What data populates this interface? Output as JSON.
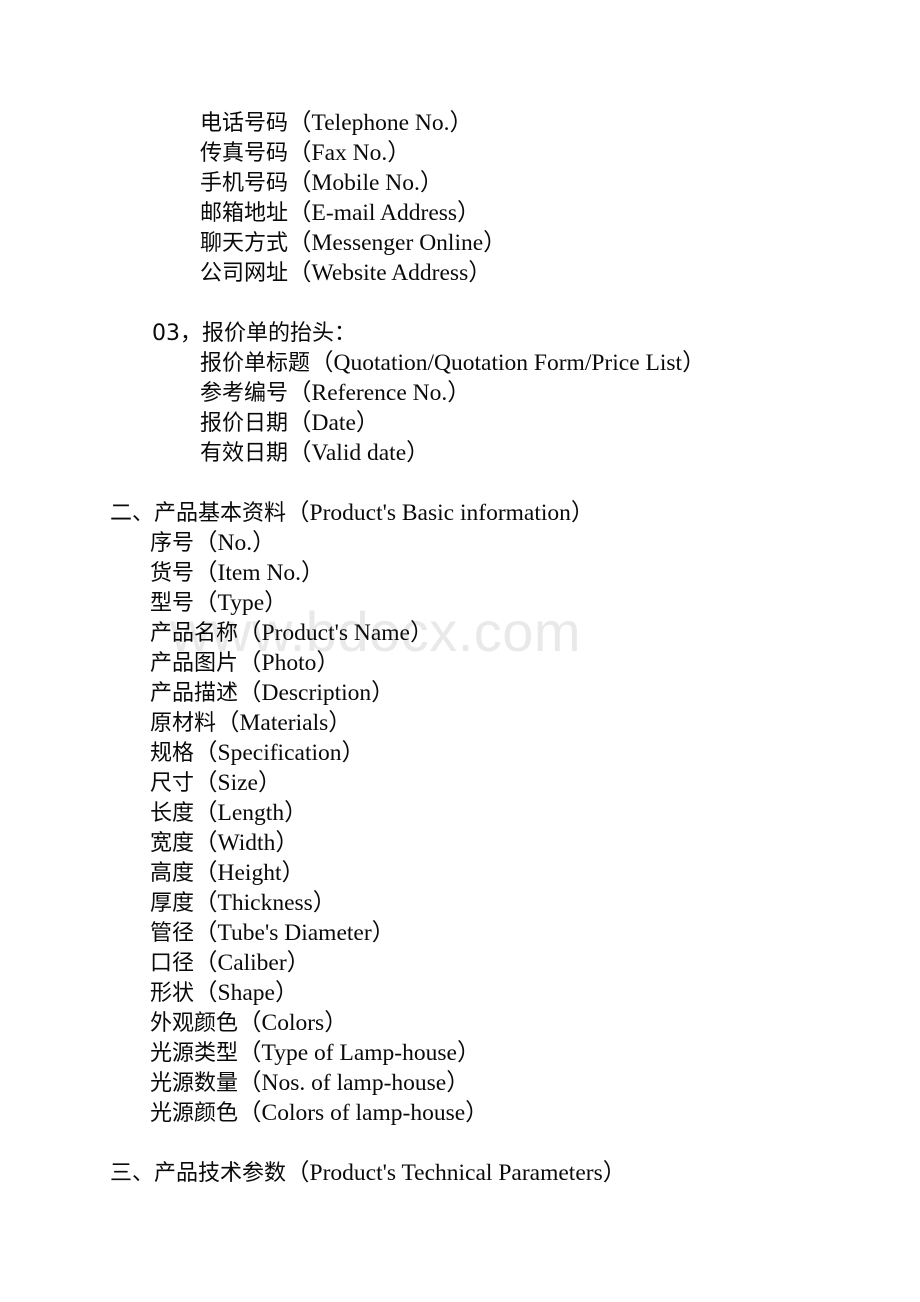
{
  "document": {
    "watermark": "www.bdocx.com",
    "blocks": [
      {
        "type": "list",
        "indent": "a",
        "items": [
          {
            "cn": "电话号码",
            "en": "（Telephone No.）"
          },
          {
            "cn": "传真号码",
            "en": "（Fax No.）"
          },
          {
            "cn": "手机号码",
            "en": "（Mobile No.）"
          },
          {
            "cn": "邮箱地址",
            "en": "（E-mail Address）"
          },
          {
            "cn": "聊天方式",
            "en": "（Messenger Online）"
          },
          {
            "cn": "公司网址",
            "en": "（Website Address）"
          }
        ]
      },
      {
        "type": "spacer"
      },
      {
        "type": "heading-num",
        "indent": "num",
        "cn": "03，报价单的抬头：",
        "en": ""
      },
      {
        "type": "list",
        "indent": "a",
        "items": [
          {
            "cn": "报价单标题",
            "en": "（Quotation/Quotation Form/Price List）"
          },
          {
            "cn": "参考编号",
            "en": "（Reference No.）"
          },
          {
            "cn": "报价日期",
            "en": "（Date）"
          },
          {
            "cn": "有效日期",
            "en": "（Valid date）"
          }
        ]
      },
      {
        "type": "spacer"
      },
      {
        "type": "heading",
        "indent": "h1",
        "cn": "二、产品基本资料",
        "en": "（Product's Basic information）"
      },
      {
        "type": "list",
        "indent": "b",
        "items": [
          {
            "cn": "序号",
            "en": "（No.）"
          },
          {
            "cn": "货号",
            "en": "（Item No.）"
          },
          {
            "cn": "型号",
            "en": "（Type）"
          },
          {
            "cn": "产品名称",
            "en": "（Product's Name）"
          },
          {
            "cn": "产品图片",
            "en": "（Photo）"
          },
          {
            "cn": "产品描述",
            "en": "（Description）"
          },
          {
            "cn": "原材料",
            "en": "（Materials）"
          },
          {
            "cn": "规格",
            "en": "（Specification）"
          },
          {
            "cn": "尺寸",
            "en": "（Size）"
          },
          {
            "cn": "长度",
            "en": "（Length）"
          },
          {
            "cn": "宽度",
            "en": "（Width）"
          },
          {
            "cn": "高度",
            "en": "（Height）"
          },
          {
            "cn": "厚度",
            "en": "（Thickness）"
          },
          {
            "cn": "管径",
            "en": "（Tube's Diameter）"
          },
          {
            "cn": "口径",
            "en": "（Caliber）"
          },
          {
            "cn": "形状",
            "en": "（Shape）"
          },
          {
            "cn": "外观颜色",
            "en": "（Colors）"
          },
          {
            "cn": "光源类型",
            "en": "（Type of Lamp-house）"
          },
          {
            "cn": "光源数量",
            "en": "（Nos. of lamp-house）"
          },
          {
            "cn": "光源颜色",
            "en": "（Colors of lamp-house）"
          }
        ]
      },
      {
        "type": "spacer"
      },
      {
        "type": "heading",
        "indent": "h1",
        "cn": "三、产品技术参数",
        "en": "（Product's Technical Parameters）"
      }
    ]
  }
}
